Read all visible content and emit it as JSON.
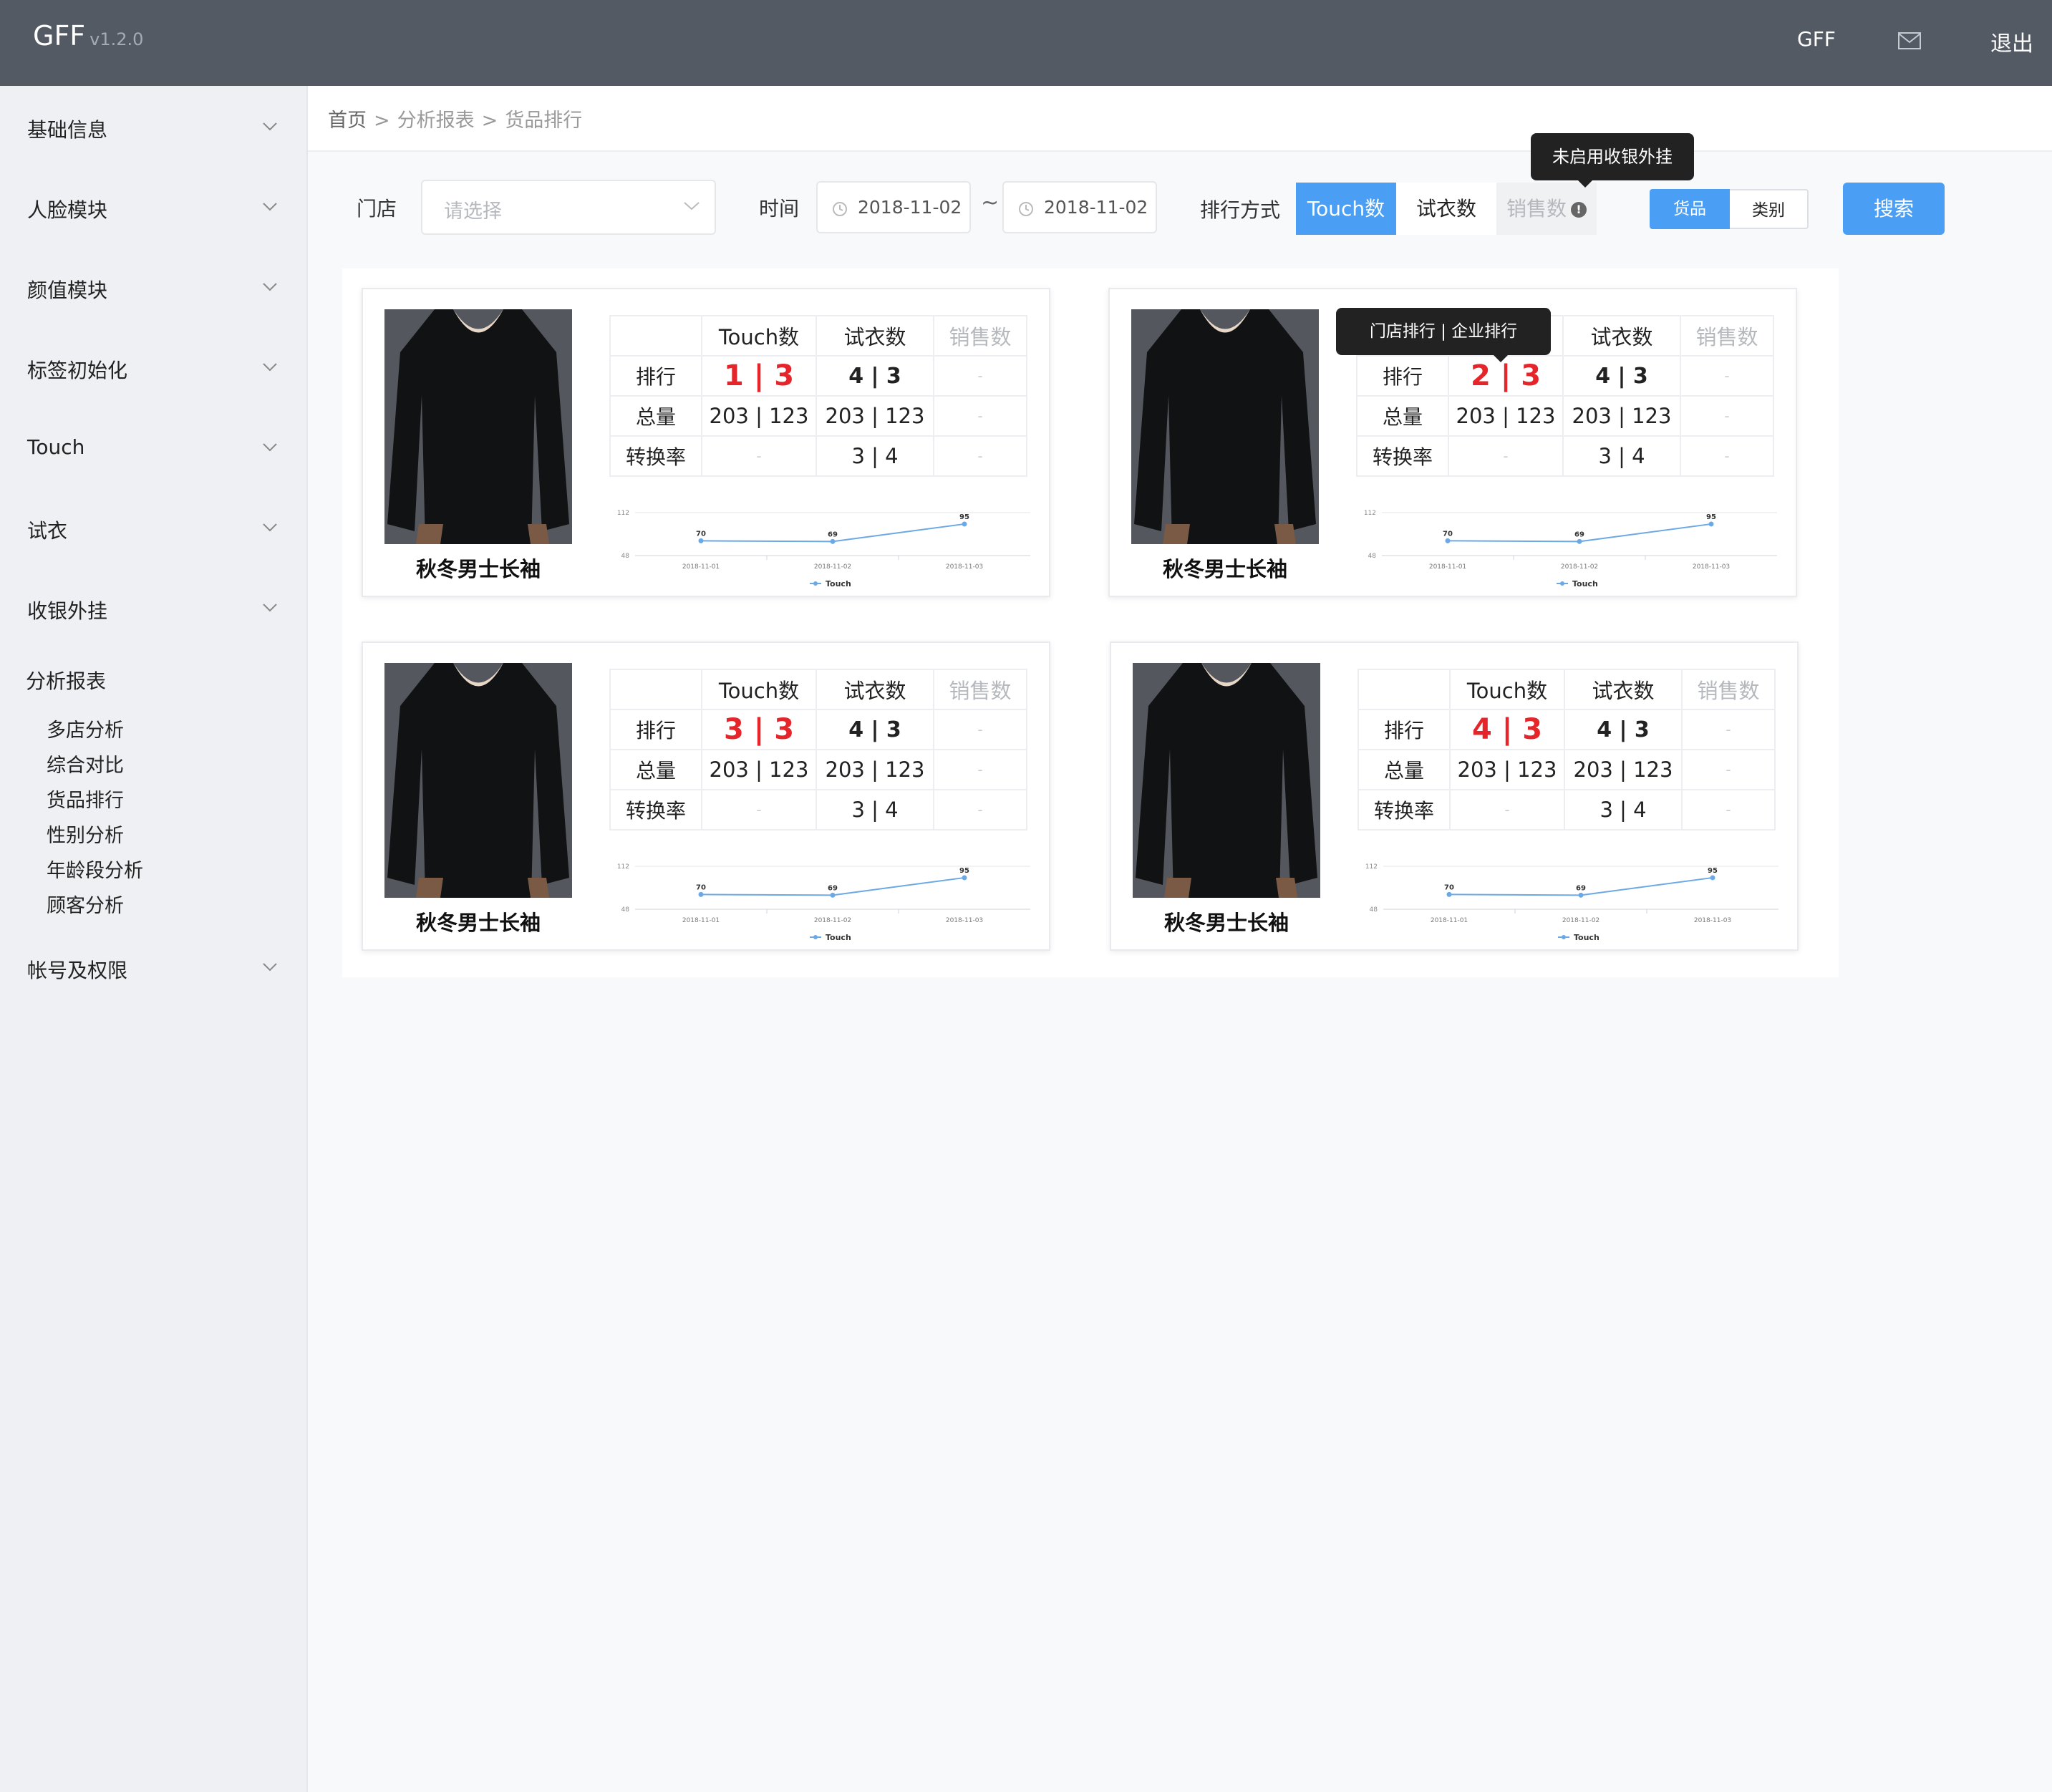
{
  "header": {
    "brand": "GFF",
    "version": "v1.2.0",
    "user": "GFF",
    "logout": "退出"
  },
  "sidebar": {
    "items": [
      {
        "label": "基础信息"
      },
      {
        "label": "人脸模块"
      },
      {
        "label": "颜值模块"
      },
      {
        "label": "标签初始化"
      },
      {
        "label": "Touch"
      },
      {
        "label": "试衣"
      },
      {
        "label": "收银外挂"
      },
      {
        "label": "分析报表"
      },
      {
        "label": "帐号及权限"
      }
    ],
    "subitems": [
      {
        "label": "多店分析"
      },
      {
        "label": "综合对比"
      },
      {
        "label": "货品排行"
      },
      {
        "label": "性别分析"
      },
      {
        "label": "年龄段分析"
      },
      {
        "label": "顾客分析"
      }
    ]
  },
  "breadcrumb": {
    "home": "首页",
    "sep": ">",
    "level1": "分析报表",
    "level2": "货品排行"
  },
  "filters": {
    "store_label": "门店",
    "store_placeholder": "请选择",
    "time_label": "时间",
    "date_from": "2018-11-02",
    "date_sep": "~",
    "date_to": "2018-11-02",
    "sort_label": "排行方式",
    "sort_options": [
      "Touch数",
      "试衣数",
      "销售数"
    ],
    "sort_selected": "Touch数",
    "sort_tooltip": "未启用收银外挂",
    "type_options": [
      "货品",
      "类别"
    ],
    "type_selected": "货品",
    "search": "搜索"
  },
  "rank_tooltip": "门店排行 | 企业排行",
  "table_headers": {
    "touch": "Touch数",
    "tryon": "试衣数",
    "sales": "销售数"
  },
  "row_labels": {
    "rank": "排行",
    "total": "总量",
    "conv": "转换率"
  },
  "dash": "-",
  "cards": [
    {
      "name": "秋冬男士长袖",
      "touch_rank": "1 | 3",
      "tryon_rank": "4 | 3",
      "touch_total": "203 | 123",
      "tryon_total": "203 | 123",
      "tryon_conv": "3 | 4"
    },
    {
      "name": "秋冬男士长袖",
      "touch_rank": "2 | 3",
      "tryon_rank": "4 | 3",
      "touch_total": "203 | 123",
      "tryon_total": "203 | 123",
      "tryon_conv": "3 | 4"
    },
    {
      "name": "秋冬男士长袖",
      "touch_rank": "3 | 3",
      "tryon_rank": "4 | 3",
      "touch_total": "203 | 123",
      "tryon_total": "203 | 123",
      "tryon_conv": "3 | 4"
    },
    {
      "name": "秋冬男士长袖",
      "touch_rank": "4 | 3",
      "tryon_rank": "4 | 3",
      "touch_total": "203 | 123",
      "tryon_total": "203 | 123",
      "tryon_conv": "3 | 4"
    }
  ],
  "chart_data": {
    "type": "line",
    "x": [
      "2018-11-01",
      "2018-11-02",
      "2018-11-03"
    ],
    "series": [
      {
        "name": "Touch",
        "values": [
          70,
          69,
          95
        ]
      }
    ],
    "yticks": [
      48,
      112
    ],
    "ylim": [
      48,
      112
    ],
    "legend": "bottom",
    "color": "#6aa8e6"
  },
  "colors": {
    "accent": "#4a9ff5",
    "header": "#535a63",
    "rank_red": "#e5252a"
  }
}
